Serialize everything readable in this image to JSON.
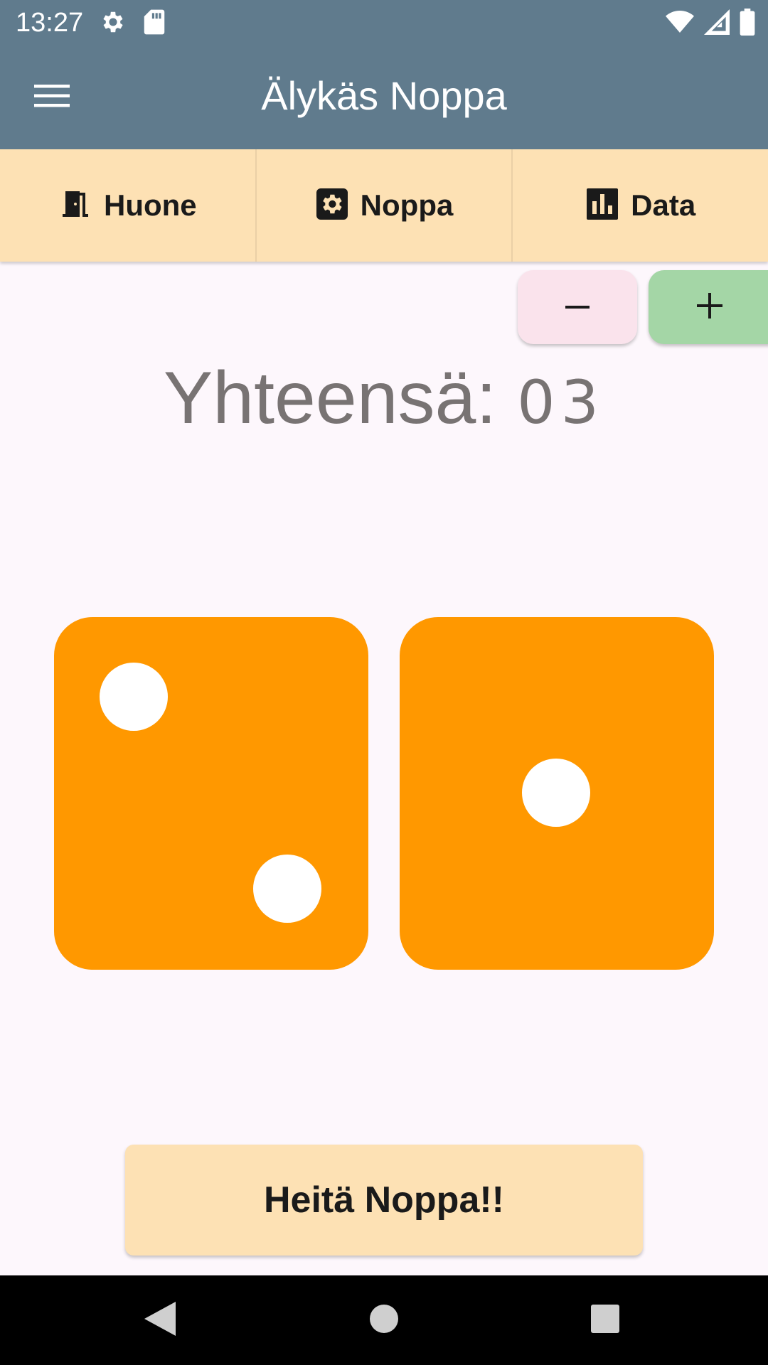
{
  "status_bar": {
    "time": "13:27",
    "left_icons": [
      "settings-icon",
      "sd-card-icon"
    ],
    "right_icons": [
      "wifi-icon",
      "cellular-icon",
      "battery-icon"
    ]
  },
  "app_bar": {
    "title": "Älykäs Noppa",
    "menu_icon": "hamburger-menu-icon"
  },
  "tabs": [
    {
      "label": "Huone",
      "icon": "door-icon"
    },
    {
      "label": "Noppa",
      "icon": "die-settings-icon"
    },
    {
      "label": "Data",
      "icon": "bar-chart-icon"
    }
  ],
  "stepper": {
    "minus_label": "−",
    "plus_label": "+"
  },
  "total": {
    "label": "Yhteensä: ",
    "value": "03"
  },
  "dice": [
    {
      "value": 2,
      "color": "#ff9800"
    },
    {
      "value": 1,
      "color": "#ff9800"
    }
  ],
  "roll_button": {
    "label": "Heitä Noppa!!"
  },
  "nav_bar": {
    "buttons": [
      "back-icon",
      "home-icon",
      "recents-icon"
    ]
  },
  "colors": {
    "app_bar": "#607b8d",
    "tab_bar": "#fde1b4",
    "die": "#ff9800",
    "plus_button": "#a4d6a6",
    "minus_button": "#fae3ec"
  }
}
